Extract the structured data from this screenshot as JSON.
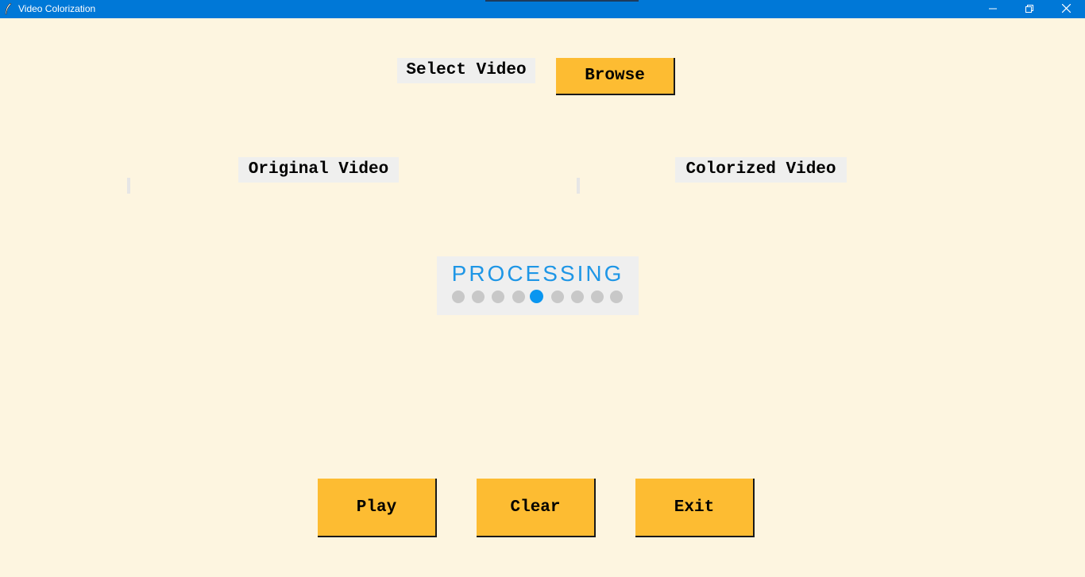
{
  "window": {
    "title": "Video Colorization",
    "titlebar_color": "#0078d7",
    "controls": [
      "minimize-icon",
      "restore-icon",
      "close-icon"
    ]
  },
  "select_video": {
    "label": "Select Video",
    "browse_label": "Browse"
  },
  "panels": {
    "original_label": "Original Video",
    "colorized_label": "Colorized Video"
  },
  "processing": {
    "text": "PROCESSING",
    "dot_count": 9,
    "active_dot": 5,
    "accent_color": "#1e96e6"
  },
  "actions": {
    "play_label": "Play",
    "clear_label": "Clear",
    "exit_label": "Exit"
  },
  "colors": {
    "background": "#fdf5e0",
    "button": "#fdbc32",
    "label_bg": "#efefee"
  }
}
